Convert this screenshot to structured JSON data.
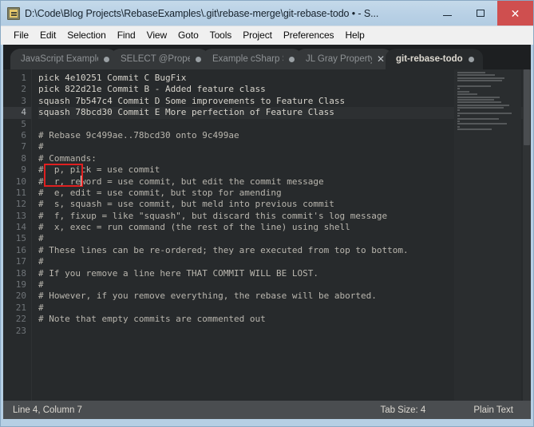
{
  "window": {
    "title": "D:\\Code\\Blog Projects\\RebaseExamples\\.git\\rebase-merge\\git-rebase-todo • - S...",
    "app_icon": "sublime-text-icon",
    "buttons": {
      "minimize": "minimize-icon",
      "maximize": "maximize-icon",
      "close": "✕"
    },
    "accent_border": "#b6cfe4",
    "close_button_color": "#cf4f4f"
  },
  "menubar": {
    "items": [
      "File",
      "Edit",
      "Selection",
      "Find",
      "View",
      "Goto",
      "Tools",
      "Project",
      "Preferences",
      "Help"
    ]
  },
  "tabs": [
    {
      "label": "JavaScript Example",
      "mark": "dot",
      "active": false
    },
    {
      "label": "SELECT @Property",
      "mark": "dot",
      "active": false
    },
    {
      "label": "Example cSharp So",
      "mark": "dot",
      "active": false
    },
    {
      "label": "JL Gray Property N",
      "mark": "x",
      "active": false
    },
    {
      "label": "git-rebase-todo",
      "mark": "dot",
      "active": true
    }
  ],
  "editor": {
    "current_line": 4,
    "annotation": {
      "type": "red-highlight-box",
      "color": "#e02020",
      "covers": "squash keywords on lines 3 and 4"
    },
    "lines": [
      {
        "n": 1,
        "text": "pick 4e10251 Commit C BugFix",
        "comment": false
      },
      {
        "n": 2,
        "text": "pick 822d21e Commit B - Added feature class",
        "comment": false
      },
      {
        "n": 3,
        "text": "squash 7b547c4 Commit D Some improvements to Feature Class",
        "comment": false
      },
      {
        "n": 4,
        "text": "squash 78bcd30 Commit E More perfection of Feature Class",
        "comment": false
      },
      {
        "n": 5,
        "text": "",
        "comment": false
      },
      {
        "n": 6,
        "text": "# Rebase 9c499ae..78bcd30 onto 9c499ae",
        "comment": true
      },
      {
        "n": 7,
        "text": "#",
        "comment": true
      },
      {
        "n": 8,
        "text": "# Commands:",
        "comment": true
      },
      {
        "n": 9,
        "text": "#  p, pick = use commit",
        "comment": true
      },
      {
        "n": 10,
        "text": "#  r, reword = use commit, but edit the commit message",
        "comment": true
      },
      {
        "n": 11,
        "text": "#  e, edit = use commit, but stop for amending",
        "comment": true
      },
      {
        "n": 12,
        "text": "#  s, squash = use commit, but meld into previous commit",
        "comment": true
      },
      {
        "n": 13,
        "text": "#  f, fixup = like \"squash\", but discard this commit's log message",
        "comment": true
      },
      {
        "n": 14,
        "text": "#  x, exec = run command (the rest of the line) using shell",
        "comment": true
      },
      {
        "n": 15,
        "text": "#",
        "comment": true
      },
      {
        "n": 16,
        "text": "# These lines can be re-ordered; they are executed from top to bottom.",
        "comment": true
      },
      {
        "n": 17,
        "text": "#",
        "comment": true
      },
      {
        "n": 18,
        "text": "# If you remove a line here THAT COMMIT WILL BE LOST.",
        "comment": true
      },
      {
        "n": 19,
        "text": "#",
        "comment": true
      },
      {
        "n": 20,
        "text": "# However, if you remove everything, the rebase will be aborted.",
        "comment": true
      },
      {
        "n": 21,
        "text": "#",
        "comment": true
      },
      {
        "n": 22,
        "text": "# Note that empty commits are commented out",
        "comment": true
      },
      {
        "n": 23,
        "text": "",
        "comment": false
      }
    ]
  },
  "minimap": {
    "name": "minimap-preview"
  },
  "statusbar": {
    "position": "Line 4, Column 7",
    "tab_size": "Tab Size: 4",
    "syntax": "Plain Text"
  }
}
